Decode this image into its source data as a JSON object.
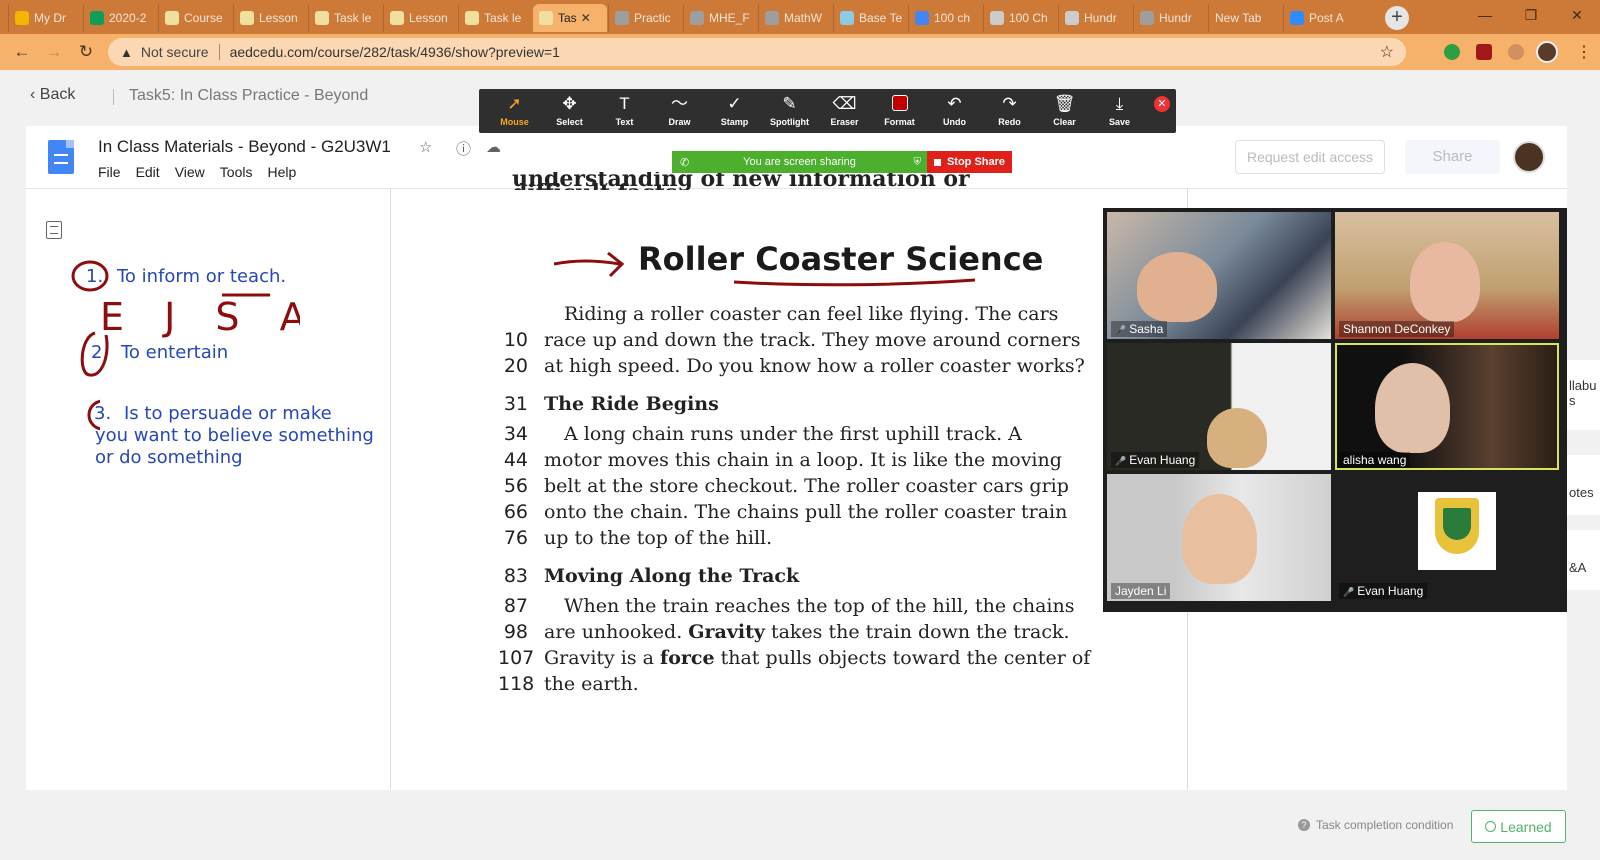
{
  "browser": {
    "tabs": [
      {
        "label": "My Dr",
        "icon_color": "#f4b400",
        "active": false
      },
      {
        "label": "2020-2",
        "icon_color": "#0f9d58",
        "active": false
      },
      {
        "label": "Course",
        "icon_color": "#f0e0a0",
        "active": false
      },
      {
        "label": "Lesson",
        "icon_color": "#f0e0a0",
        "active": false
      },
      {
        "label": "Task le",
        "icon_color": "#f0e0a0",
        "active": false
      },
      {
        "label": "Lesson",
        "icon_color": "#f0e0a0",
        "active": false
      },
      {
        "label": "Task le",
        "icon_color": "#f0e0a0",
        "active": false
      },
      {
        "label": "Tas",
        "icon_color": "#f0e0a0",
        "active": true
      },
      {
        "label": "Practic",
        "icon_color": "#9e9e9e",
        "active": false
      },
      {
        "label": "MHE_F",
        "icon_color": "#9e9e9e",
        "active": false
      },
      {
        "label": "MathW",
        "icon_color": "#9e9e9e",
        "active": false
      },
      {
        "label": "Base Te",
        "icon_color": "#8ecae6",
        "active": false
      },
      {
        "label": "100 ch",
        "icon_color": "#4285f4",
        "active": false
      },
      {
        "label": "100 Ch",
        "icon_color": "#cccccc",
        "active": false
      },
      {
        "label": "Hundr",
        "icon_color": "#cccccc",
        "active": false
      },
      {
        "label": "Hundr",
        "icon_color": "#9e9e9e",
        "active": false
      },
      {
        "label": "New Tab",
        "icon_color": "",
        "active": false
      },
      {
        "label": "Post A",
        "icon_color": "#2d8cff",
        "active": false
      }
    ],
    "not_secure": "Not secure",
    "url": "aedcedu.com/course/282/task/4936/show?preview=1",
    "tabstrip_color": "#cd7a39",
    "addressbar_color": "#f6b26b"
  },
  "course": {
    "back_label": "Back",
    "task_title": "Task5:  In Class Practice - Beyond"
  },
  "annotate_toolbar": {
    "tools": [
      {
        "icon": "cursor-icon",
        "glyph": "➚",
        "label": "Mouse",
        "active": true
      },
      {
        "icon": "move-icon",
        "glyph": "✥",
        "label": "Select"
      },
      {
        "icon": "text-icon",
        "glyph": "T",
        "label": "Text"
      },
      {
        "icon": "draw-icon",
        "glyph": "〜",
        "label": "Draw"
      },
      {
        "icon": "stamp-icon",
        "glyph": "✓",
        "label": "Stamp"
      },
      {
        "icon": "spotlight-icon",
        "glyph": "✎",
        "label": "Spotlight"
      },
      {
        "icon": "eraser-icon",
        "glyph": "⌫",
        "label": "Eraser"
      },
      {
        "icon": "format-icon",
        "glyph": "",
        "label": "Format"
      },
      {
        "icon": "undo-icon",
        "glyph": "↶",
        "label": "Undo"
      },
      {
        "icon": "redo-icon",
        "glyph": "↷",
        "label": "Redo"
      },
      {
        "icon": "trash-icon",
        "glyph": "🗑",
        "label": "Clear"
      },
      {
        "icon": "save-icon",
        "glyph": "⤓",
        "label": "Save"
      }
    ]
  },
  "doc": {
    "title": "In Class Materials - Beyond - G2U3W1",
    "menu": [
      "File",
      "Edit",
      "View",
      "Tools",
      "Help"
    ],
    "request_edit": "Request edit access",
    "share": "Share"
  },
  "screen_share": {
    "status": "You are screen sharing",
    "stop": "Stop Share"
  },
  "notes": {
    "item1_num": "1.",
    "item1": "To inform or teach.",
    "item2_num": "2.",
    "item2": "To entertain",
    "item3_num": "3.",
    "item3_line1": "Is to persuade or make",
    "item3_line2": "you want to believe something",
    "item3_line3": "or do something",
    "handwriting": "E J S A"
  },
  "book": {
    "cut_line": "understanding of new information or difficult facts.",
    "heading": "Roller Coaster Science",
    "lines": [
      {
        "n": "",
        "t": "Riding a roller coaster can feel like flying. The cars",
        "indent": true
      },
      {
        "n": "10",
        "t": "race up and down the track. They move around corners"
      },
      {
        "n": "20",
        "t": "at high speed. Do you know how a roller coaster works?"
      },
      {
        "n": "31",
        "t": "The Ride Begins",
        "sub": true
      },
      {
        "n": "34",
        "t": "A long chain runs under the first uphill track. A",
        "indent": true
      },
      {
        "n": "44",
        "t": "motor moves this chain in a loop. It is like the moving"
      },
      {
        "n": "56",
        "t": "belt at the store checkout. The roller coaster cars grip"
      },
      {
        "n": "66",
        "t": "onto the chain. The chains pull the roller coaster train"
      },
      {
        "n": "76",
        "t": "up to the top of the hill."
      },
      {
        "n": "83",
        "t": "Moving Along the Track",
        "sub": true
      },
      {
        "n": "87",
        "t": "When the train reaches the top of the hill, the chains",
        "indent": true
      },
      {
        "n": "98",
        "t": "are unhooked. Gravity takes the train down the track."
      },
      {
        "n": "107",
        "t": "Gravity is a force that pulls objects toward the center of"
      },
      {
        "n": "118",
        "t": "the earth."
      }
    ]
  },
  "zoom": {
    "participants": [
      {
        "name": "Sasha",
        "muted": true
      },
      {
        "name": "Shannon DeConkey",
        "muted": false
      },
      {
        "name": "Evan Huang",
        "muted": true
      },
      {
        "name": "alisha wang",
        "muted": false
      },
      {
        "name": "Jayden Li",
        "muted": false
      },
      {
        "name": "Evan Huang",
        "muted": true
      }
    ]
  },
  "side_peek": {
    "item1": "llabu s",
    "item2": "otes",
    "item3": "&A"
  },
  "footer": {
    "task_condition": "Task completion condition",
    "learned": "Learned"
  },
  "colors": {
    "ink_blue": "#2747b5",
    "ink_red": "#8b0d0d",
    "share_green": "#4caf2d",
    "stop_red": "#e0211a",
    "learned_green": "#54b36a"
  }
}
